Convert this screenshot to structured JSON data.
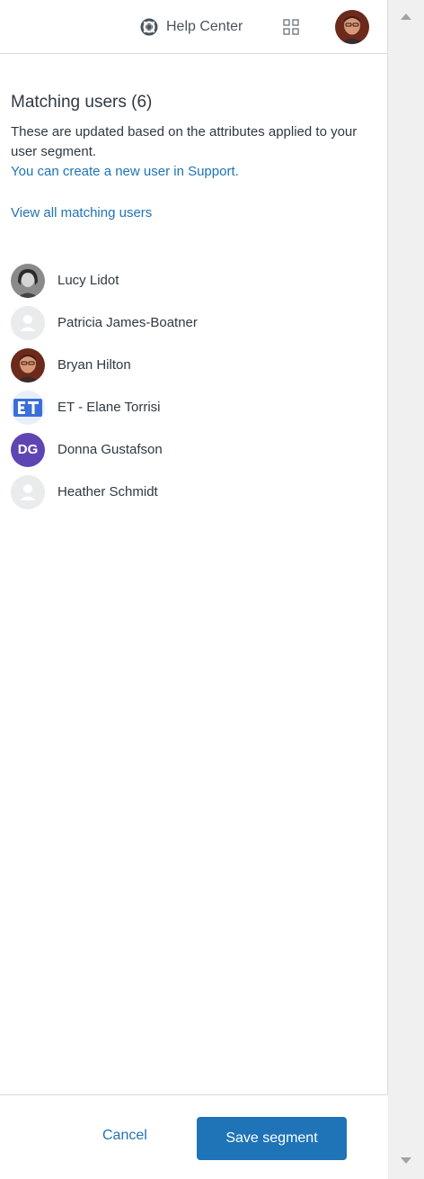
{
  "header": {
    "help_center_label": "Help Center",
    "icons": [
      "help-center-icon",
      "apps-grid-icon",
      "user-avatar"
    ]
  },
  "matching": {
    "title": "Matching users (6)",
    "description": "These are updated based on the attributes applied to your user segment.",
    "create_link": "You can create a new user in Support.",
    "view_all_link": "View all matching users"
  },
  "users": [
    {
      "name": "Lucy Lidot",
      "avatar": "photo"
    },
    {
      "name": "Patricia James-Boatner",
      "avatar": "default"
    },
    {
      "name": "Bryan Hilton",
      "avatar": "photo"
    },
    {
      "name": "ET - Elane Torrisi",
      "avatar": "image"
    },
    {
      "name": "Donna Gustafson",
      "avatar": "initials",
      "initials": "DG"
    },
    {
      "name": "Heather Schmidt",
      "avatar": "default"
    }
  ],
  "footer": {
    "cancel_label": "Cancel",
    "save_label": "Save segment"
  },
  "colors": {
    "link": "#1f73b7",
    "primary_button": "#1f73b7",
    "initials_avatar": "#5f45b4",
    "text": "#2f3941"
  }
}
